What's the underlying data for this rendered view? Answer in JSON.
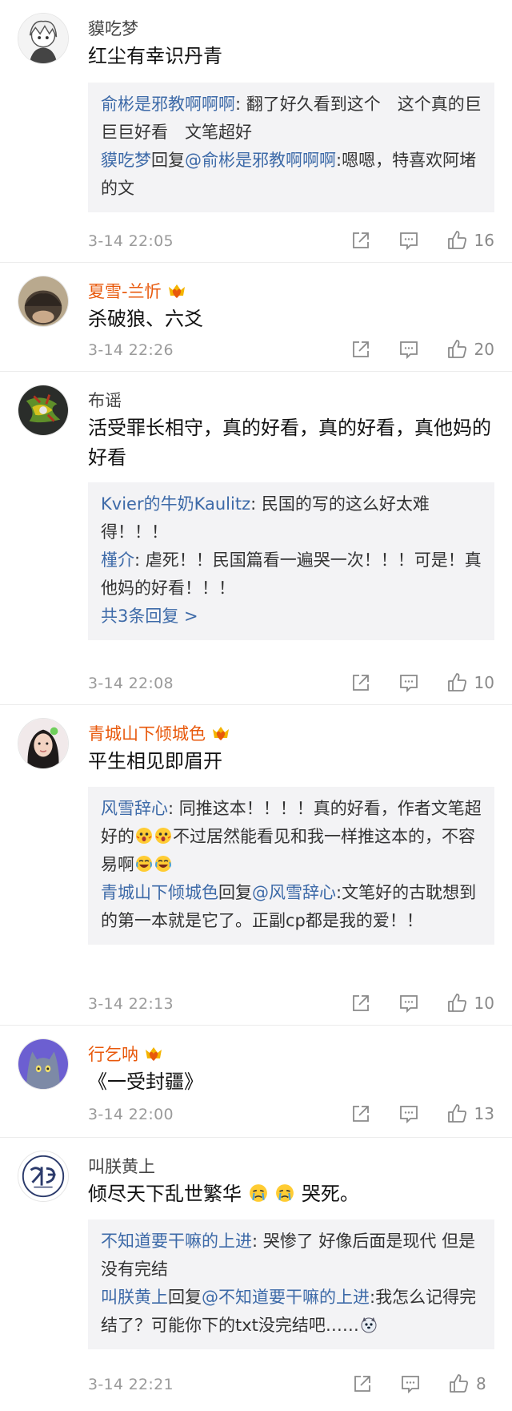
{
  "comments": [
    {
      "username": "貘吃梦",
      "text": "红尘有幸识丹青",
      "replies": [
        {
          "name": "俞彬是邪教啊啊啊",
          "sep": ":",
          "text": " 翻了好久看到这个　这个真的巨巨巨好看　文笔超好"
        },
        {
          "name": "貘吃梦",
          "mid": "回复",
          "target": "@俞彬是邪教啊啊啊",
          "sep": ":",
          "text": "嗯嗯，特喜欢阿堵的文"
        }
      ],
      "time": "3-14 22:05",
      "likes": "16"
    },
    {
      "username": "夏雪-兰忻",
      "text": "杀破狼、六爻",
      "time": "3-14 22:26",
      "likes": "20"
    },
    {
      "username": "布谣",
      "text": "活受罪长相守，真的好看，真的好看，真他妈的好看",
      "replies": [
        {
          "name": "Kvier的牛奶Kaulitz",
          "sep": ":",
          "text": " 民国的写的这么好太难得！！！"
        },
        {
          "name": "槿介",
          "sep": ":",
          "text": " 虐死！！民国篇看一遍哭一次！！！可是！真他妈的好看！！！"
        }
      ],
      "more": "共3条回复 >",
      "time": "3-14 22:08",
      "likes": "10"
    },
    {
      "username": "青城山下倾城色",
      "text": "平生相见即眉开",
      "reply1": {
        "name": "风雪辞心",
        "sep": ":",
        "a": " 同推这本！！！！真的好看，作者文笔超好的",
        "b": "不过居然能看见和我一样推这本的，不容易啊"
      },
      "reply2": {
        "name": "青城山下倾城色",
        "mid": "回复",
        "target": "@风雪辞心",
        "sep": ":",
        "text": "文笔好的古耽想到的第一本就是它了。正副cp都是我的爱！！"
      },
      "time": "3-14 22:13",
      "likes": "10"
    },
    {
      "username": "行乞呐",
      "text": "《一受封疆》",
      "time": "3-14 22:00",
      "likes": "13"
    },
    {
      "username": "叫朕黄上",
      "text_a": "倾尽天下乱世繁华",
      "text_b": "哭死。",
      "reply1": {
        "name": "不知道要干嘛的上进",
        "sep": ":",
        "text": " 哭惨了 好像后面是现代 但是没有完结"
      },
      "reply2": {
        "name": "叫朕黄上",
        "mid": "回复",
        "target": "@不知道要干嘛的上进",
        "sep": ":",
        "text": "我怎么记得完结了？可能你下的txt没完结吧……"
      },
      "time": "3-14 22:21",
      "likes": "8"
    }
  ],
  "colors": {
    "vip_name": "#e8590c",
    "reply_name": "#3d6aa8",
    "reply_bg": "#f3f3f5",
    "meta": "#9b9b9b"
  },
  "icons": {
    "share": "share-icon",
    "comment": "comment-icon",
    "like": "thumbs-up-icon",
    "vip": "vip-crown-heart-icon"
  }
}
